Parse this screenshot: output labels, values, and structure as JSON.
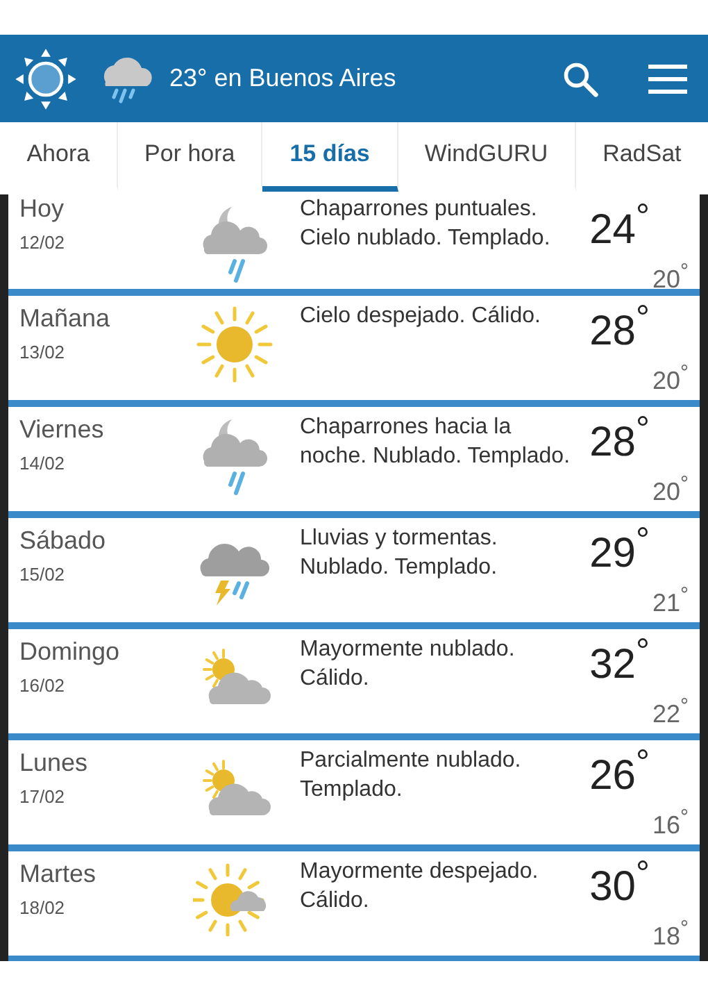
{
  "header": {
    "title": "23° en Buenos Aires"
  },
  "tabs": [
    {
      "label": "Ahora",
      "selected": false
    },
    {
      "label": "Por hora",
      "selected": false
    },
    {
      "label": "15 días",
      "selected": true
    },
    {
      "label": "WindGURU",
      "selected": false
    },
    {
      "label": "RadSat",
      "selected": false
    }
  ],
  "days": [
    {
      "day": "Hoy",
      "date": "12/02",
      "kind": "rain-night",
      "text": "Chaparrones puntuales. Cielo nublado. Templado.",
      "max": "24$^{°}$",
      "min": "20$^{°}$"
    },
    {
      "day": "Mañana",
      "date": "13/02",
      "kind": "sun",
      "text": "Cielo despejado. Cálido.",
      "max": "28$^{°}$",
      "min": "20$^{°}$"
    },
    {
      "day": "Viernes",
      "date": "14/02",
      "kind": "rain-night",
      "text": "Chaparrones hacia la noche. Nublado. Templado.",
      "max": "28$^{°}$",
      "min": "20$^{°}$"
    },
    {
      "day": "Sábado",
      "date": "15/02",
      "kind": "storm",
      "text": "Lluvias y tormentas. Nublado. Templado.",
      "max": "29$^{°}$",
      "min": "21$^{°}$"
    },
    {
      "day": "Domingo",
      "date": "16/02",
      "kind": "cloud-sun",
      "text": "Mayormente nublado. Cálido.",
      "max": "32$^{°}$",
      "min": "22$^{°}$"
    },
    {
      "day": "Lunes",
      "date": "17/02",
      "kind": "cloud-sun",
      "text": "Parcialmente nublado. Templado.",
      "max": "26$^{°}$",
      "min": "16$^{°}$"
    },
    {
      "day": "Martes",
      "date": "18/02",
      "kind": "sun-cloud",
      "text": "Mayormente despejado. Cálido.",
      "max": "30$^{°}$",
      "min": "18$^{°}$"
    }
  ]
}
